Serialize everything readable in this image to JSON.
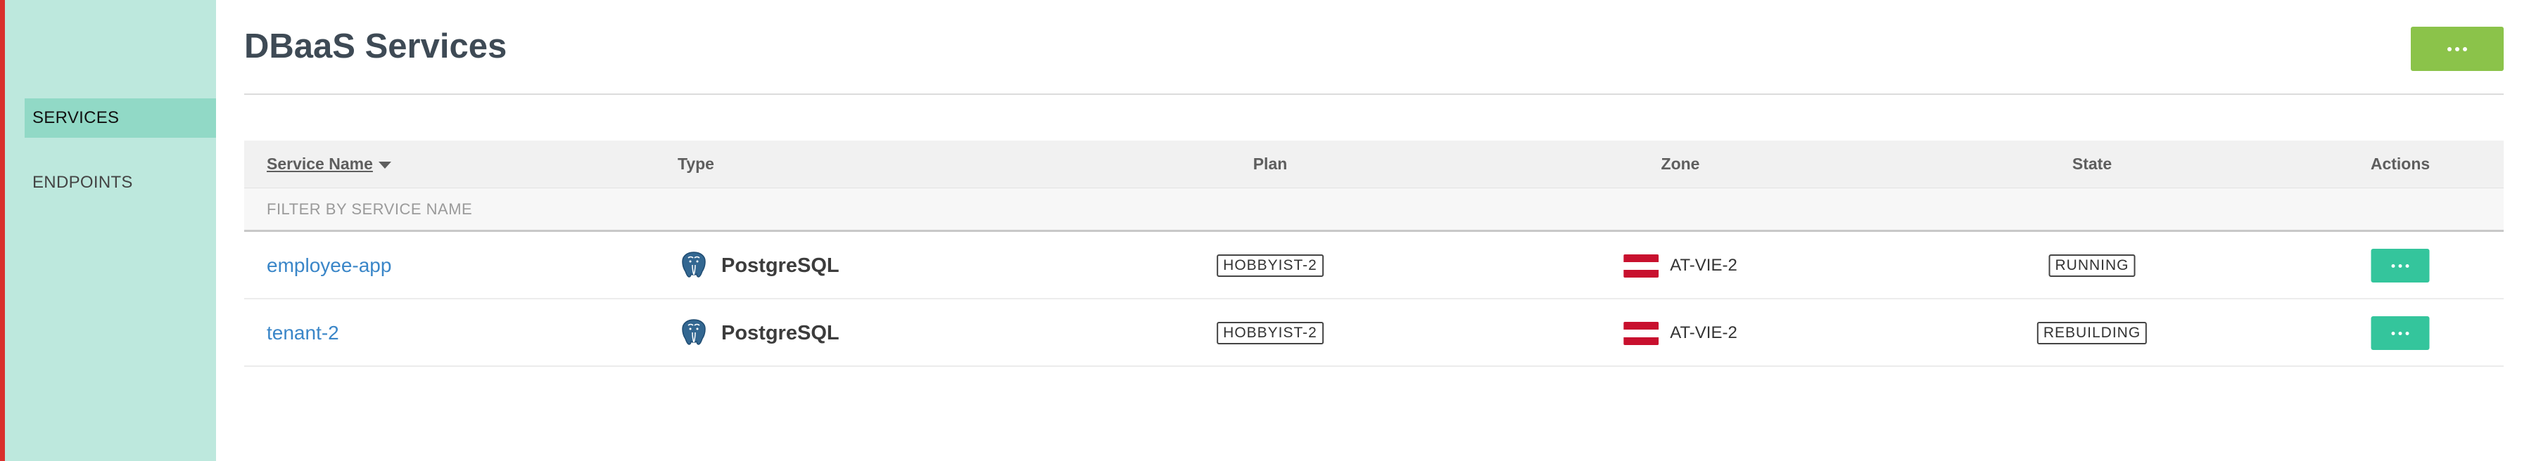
{
  "sidebar": {
    "items": [
      {
        "label": "SERVICES",
        "active": true
      },
      {
        "label": "ENDPOINTS",
        "active": false
      }
    ]
  },
  "header": {
    "title": "DBaaS Services",
    "menu_icon": "more-dots-icon"
  },
  "table": {
    "columns": {
      "service_name": "Service Name",
      "type": "Type",
      "plan": "Plan",
      "zone": "Zone",
      "state": "State",
      "actions": "Actions"
    },
    "sorted_by": "service_name",
    "filter_placeholder": "FILTER BY SERVICE NAME",
    "rows": [
      {
        "name": "employee-app",
        "type": "PostgreSQL",
        "type_icon": "postgresql-elephant-icon",
        "plan": "HOBBYIST-2",
        "zone": "AT-VIE-2",
        "zone_icon": "austria-flag-icon",
        "state": "RUNNING"
      },
      {
        "name": "tenant-2",
        "type": "PostgreSQL",
        "type_icon": "postgresql-elephant-icon",
        "plan": "HOBBYIST-2",
        "zone": "AT-VIE-2",
        "zone_icon": "austria-flag-icon",
        "state": "REBUILDING"
      }
    ]
  },
  "colors": {
    "sidebar_bg": "#bde8dd",
    "sidebar_active": "#91d9c6",
    "header_button": "#8bc34a",
    "row_button": "#34c59c",
    "link": "#3a86c8",
    "accent_strip": "#d9302c",
    "flag_red": "#c8102e",
    "flag_white": "#ffffff"
  }
}
